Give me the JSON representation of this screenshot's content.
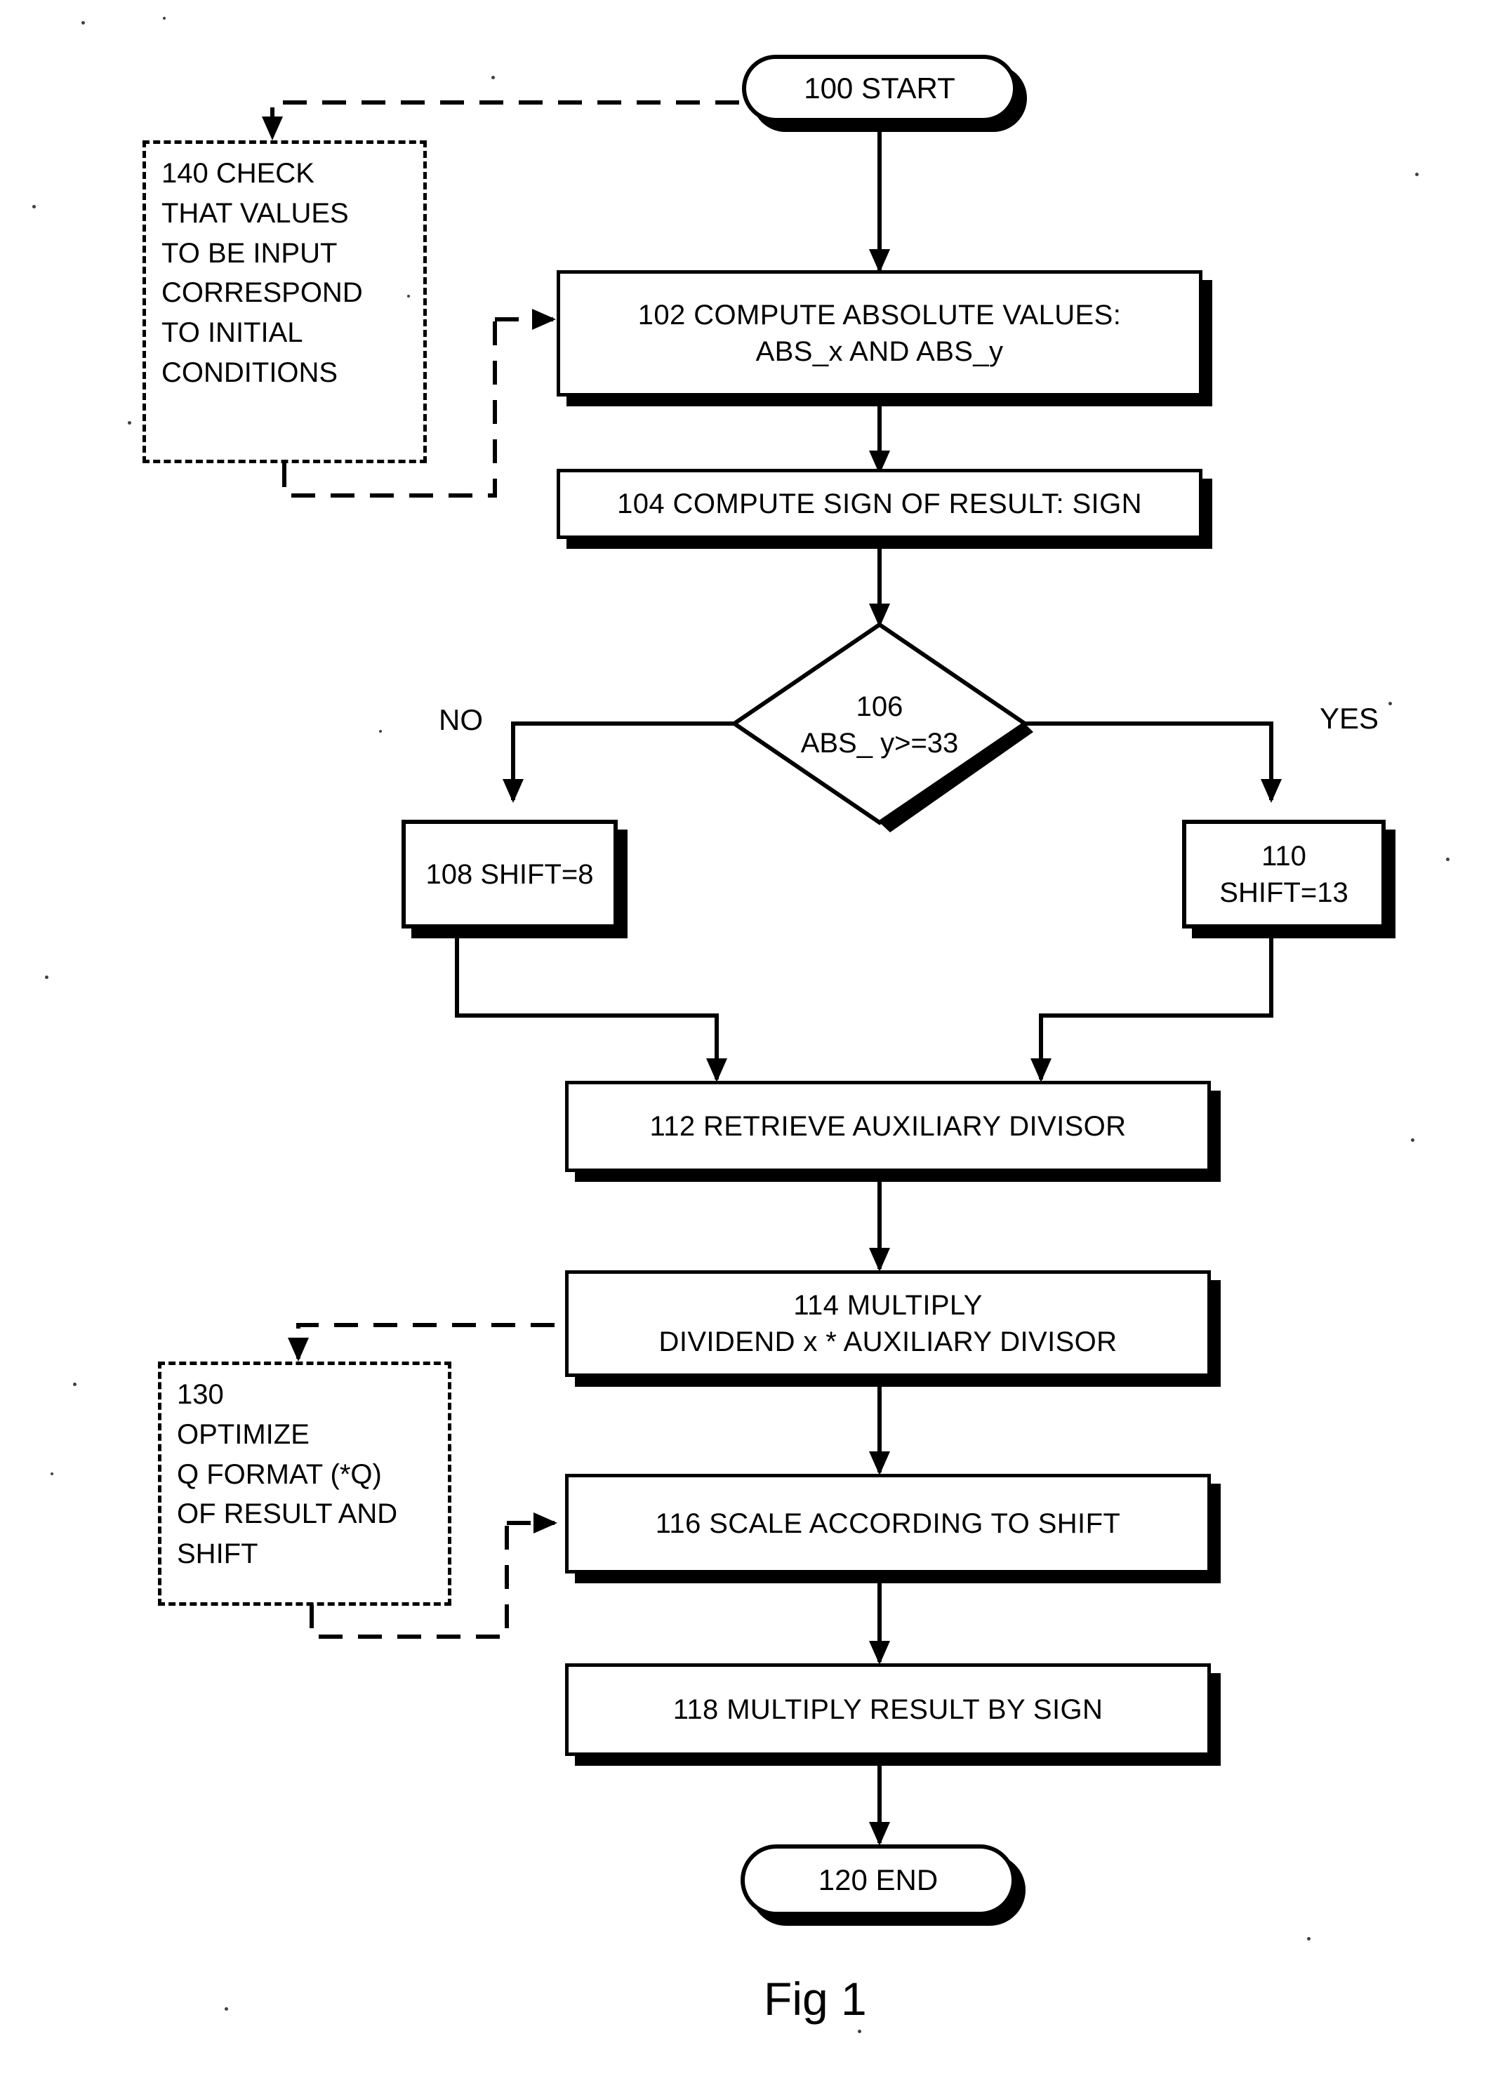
{
  "figure": {
    "caption": "Fig 1",
    "type": "flowchart"
  },
  "nodes": {
    "start": {
      "label": "100 START",
      "shape": "terminator"
    },
    "check_inputs": {
      "label": "140  CHECK\nTHAT VALUES\nTO BE INPUT\nCORRESPOND\nTO INITIAL\nCONDITIONS",
      "shape": "dashed-annotation"
    },
    "compute_abs": {
      "label": "102 COMPUTE ABSOLUTE VALUES:\nABS_x  AND  ABS_y",
      "shape": "process"
    },
    "compute_sign": {
      "label": "104 COMPUTE SIGN OF RESULT: SIGN",
      "shape": "process"
    },
    "decision": {
      "label": "106\nABS_ y>=33",
      "shape": "decision"
    },
    "shift8": {
      "label": "108 SHIFT=8",
      "shape": "process"
    },
    "shift13": {
      "label": "110\nSHIFT=13",
      "shape": "process"
    },
    "retrieve_divisor": {
      "label": "112 RETRIEVE AUXILIARY DIVISOR",
      "shape": "process"
    },
    "multiply": {
      "label": "114 MULTIPLY\nDIVIDEND x * AUXILIARY DIVISOR",
      "shape": "process"
    },
    "optimize_q": {
      "label": "130\nOPTIMIZE\nQ FORMAT (*Q)\nOF RESULT AND\nSHIFT",
      "shape": "dashed-annotation"
    },
    "scale": {
      "label": "116 SCALE ACCORDING TO SHIFT",
      "shape": "process"
    },
    "multiply_sign": {
      "label": "118 MULTIPLY RESULT BY SIGN",
      "shape": "process"
    },
    "end": {
      "label": "120 END",
      "shape": "terminator"
    }
  },
  "edge_labels": {
    "no": "NO",
    "yes": "YES"
  },
  "colors": {
    "ink": "#000000",
    "paper": "#ffffff"
  }
}
